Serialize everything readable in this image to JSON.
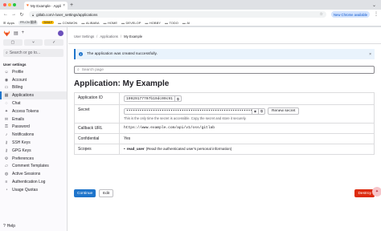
{
  "browser": {
    "tab_title": "My Example · Applications",
    "tab_close": "×",
    "tab_new": "+",
    "url": "gitlab.com/-/user_settings/applications",
    "new_chrome_label": "New Chrome available"
  },
  "bookmarks": {
    "apps": "Apps",
    "badge1": "FR-CN 翻译",
    "daily": "DAILY",
    "folders": [
      "COMMON",
      "ALIBABA",
      "HOME",
      "DEVELOP",
      "HOBBY",
      "TODO",
      "AI"
    ]
  },
  "sidebar": {
    "search_placeholder": "Search or go to...",
    "section_label": "User settings",
    "items": [
      {
        "label": "Profile",
        "icon": "profile-icon"
      },
      {
        "label": "Account",
        "icon": "account-icon"
      },
      {
        "label": "Billing",
        "icon": "billing-icon"
      },
      {
        "label": "Applications",
        "icon": "applications-icon"
      },
      {
        "label": "Chat",
        "icon": "chat-icon"
      },
      {
        "label": "Access Tokens",
        "icon": "token-icon"
      },
      {
        "label": "Emails",
        "icon": "mail-icon"
      },
      {
        "label": "Password",
        "icon": "lock-icon"
      },
      {
        "label": "Notifications",
        "icon": "bell-icon"
      },
      {
        "label": "SSH Keys",
        "icon": "key-icon"
      },
      {
        "label": "GPG Keys",
        "icon": "key-icon"
      },
      {
        "label": "Preferences",
        "icon": "preferences-icon"
      },
      {
        "label": "Comment Templates",
        "icon": "comment-icon"
      },
      {
        "label": "Active Sessions",
        "icon": "session-icon"
      },
      {
        "label": "Authentication Log",
        "icon": "log-icon"
      },
      {
        "label": "Usage Quotas",
        "icon": "quota-icon"
      }
    ],
    "help_label": "Help"
  },
  "breadcrumb": {
    "items": [
      "User Settings",
      "Applications",
      "My Example"
    ]
  },
  "alert": {
    "text": "The application was created successfully."
  },
  "search": {
    "placeholder": "Search page"
  },
  "page": {
    "title": "Application: My Example"
  },
  "details": {
    "app_id_label": "Application ID",
    "app_id_value": "19929177707b19dc09c91",
    "secret_label": "Secret",
    "secret_value": "••••••••••••••••••••••••••••••••••••••••••••••••••••••••••••••••",
    "renew_label": "Renew secret",
    "secret_help": "This is the only time the secret is accessible. Copy the secret and store it securely.",
    "callback_label": "Callback URL",
    "callback_value": "https://www.example.com/api/v1/oss/gitlab",
    "confidential_label": "Confidential",
    "confidential_value": "Yes",
    "scopes_label": "Scopes",
    "scope_name": "read_user",
    "scope_desc": "(Read the authenticated user's personal information)"
  },
  "actions": {
    "continue": "Continue",
    "edit": "Edit",
    "destroy": "Destroy"
  },
  "colors": {
    "primary": "#1f75cb",
    "danger": "#dd2b0e",
    "gitlab_orange": "#fc6d26"
  }
}
